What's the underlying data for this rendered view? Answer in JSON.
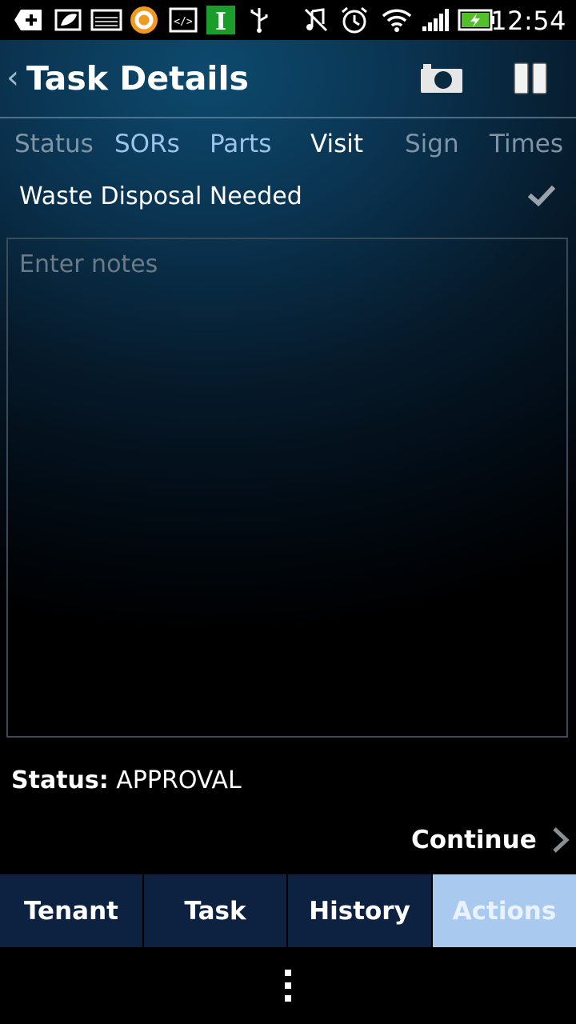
{
  "statusbar": {
    "time": "12:54",
    "icons": [
      "add-icon",
      "leaf-icon",
      "image-icon",
      "app-orange-icon",
      "code-icon",
      "i-app-icon",
      "usb-icon",
      "mute-icon",
      "alarm-icon",
      "wifi-icon",
      "signal-icon",
      "battery-charging-icon"
    ]
  },
  "header": {
    "back_symbol": "‹",
    "title": "Task Details",
    "camera_icon": "camera-icon",
    "pause_icon": "pause-icon"
  },
  "subtabs": [
    {
      "label": "Status",
      "color": "#7f95a6"
    },
    {
      "label": "SORs",
      "color": "#9cc4ea"
    },
    {
      "label": "Parts",
      "color": "#9cc4ea"
    },
    {
      "label": "Visit",
      "color": "#ffffff"
    },
    {
      "label": "Sign",
      "color": "#7f95a6"
    },
    {
      "label": "Times",
      "color": "#7f95a6"
    }
  ],
  "waste": {
    "label": "Waste Disposal Needed",
    "checked": true
  },
  "notes": {
    "placeholder": "Enter notes",
    "value": ""
  },
  "status": {
    "key": "Status:",
    "value": " APPROVAL"
  },
  "continue": {
    "label": "Continue"
  },
  "bottom_tabs": [
    {
      "label": "Tenant",
      "active": false
    },
    {
      "label": "Task",
      "active": false
    },
    {
      "label": "History",
      "active": false
    },
    {
      "label": "Actions",
      "active": true
    }
  ],
  "colors": {
    "accent_active_tab": "#a9c9ee",
    "bottom_tab_bg": "#0c2240",
    "gradient_top": "#0d4a6e"
  }
}
